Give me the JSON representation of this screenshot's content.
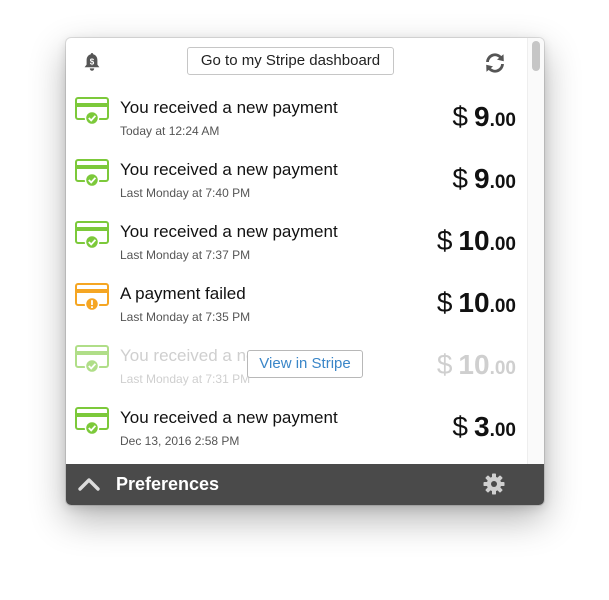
{
  "header": {
    "dashboard_button": "Go to my Stripe dashboard",
    "bell_icon": "bell-dollar-icon",
    "sync_icon": "sync-icon"
  },
  "payments": [
    {
      "title": "You received a new payment",
      "time": "Today at 12:24 AM",
      "currency": "$",
      "amount_int": "9",
      "amount_cents": ".00",
      "status": "success"
    },
    {
      "title": "You received a new payment",
      "time": "Last Monday at 7:40 PM",
      "currency": "$",
      "amount_int": "9",
      "amount_cents": ".00",
      "status": "success"
    },
    {
      "title": "You received a new payment",
      "time": "Last Monday at 7:37 PM",
      "currency": "$",
      "amount_int": "10",
      "amount_cents": ".00",
      "status": "success"
    },
    {
      "title": "A payment failed",
      "time": "Last Monday at 7:35 PM",
      "currency": "$",
      "amount_int": "10",
      "amount_cents": ".00",
      "status": "failed"
    },
    {
      "title": "You received a new payment",
      "time": "Last Monday at 7:31 PM",
      "currency": "$",
      "amount_int": "10",
      "amount_cents": ".00",
      "status": "success"
    },
    {
      "title": "You received a new payment",
      "time": "Dec 13, 2016 2:58 PM",
      "currency": "$",
      "amount_int": "3",
      "amount_cents": ".00",
      "status": "success"
    }
  ],
  "hover": {
    "view_button": "View in Stripe"
  },
  "footer": {
    "preferences_label": "Preferences"
  },
  "colors": {
    "success": "#7cc93a",
    "failed": "#f5a623",
    "footer_bg": "#4a4a4a",
    "link_blue": "#3a86c8"
  }
}
